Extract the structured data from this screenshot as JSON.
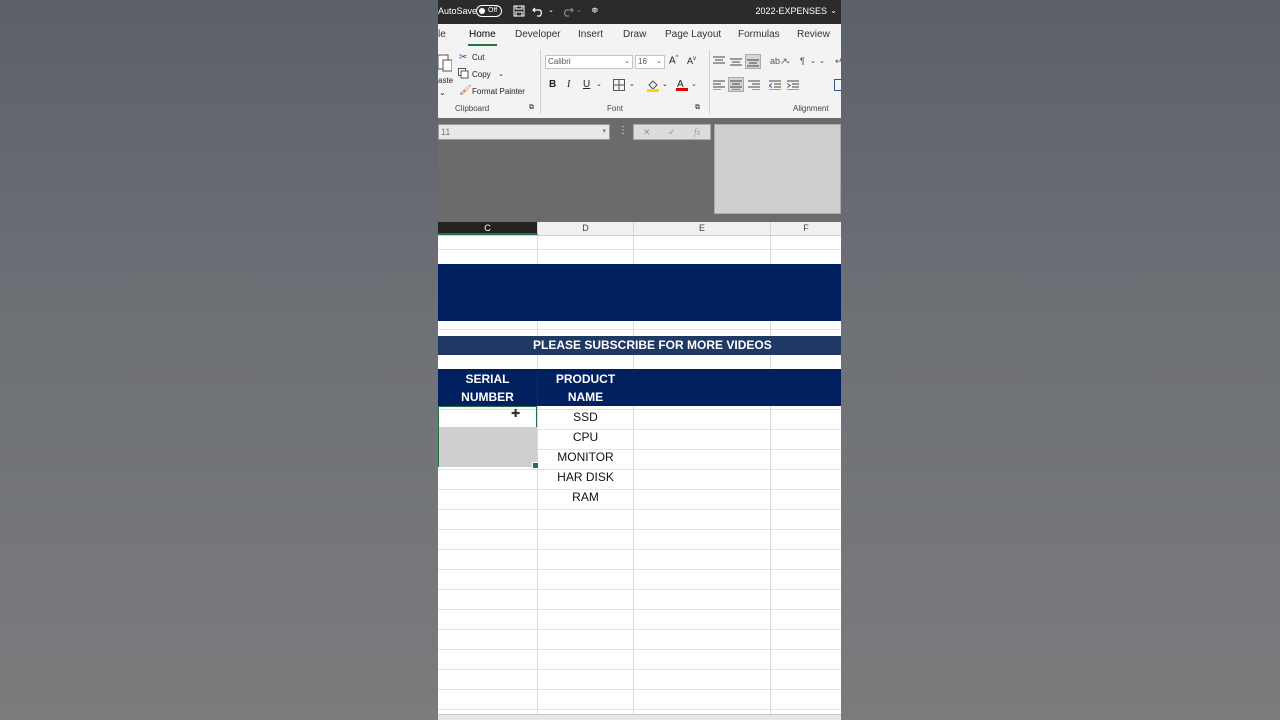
{
  "titlebar": {
    "autosave_label": "AutoSave",
    "autosave_state": "Off",
    "filename": "2022-EXPENSES"
  },
  "tabs": [
    "le",
    "Home",
    "Developer",
    "Insert",
    "Draw",
    "Page Layout",
    "Formulas",
    "Review"
  ],
  "ribbon": {
    "clipboard": {
      "paste_label": "aste",
      "cut": "Cut",
      "copy": "Copy",
      "format_painter": "Format Painter",
      "group_label": "Clipboard"
    },
    "font": {
      "font_name": "Calibri",
      "font_size": "16",
      "bold": "B",
      "italic": "I",
      "underline": "U",
      "group_label": "Font"
    },
    "alignment": {
      "group_label": "Alignment"
    }
  },
  "formula_bar": {
    "name_box": "11",
    "fx": "fx"
  },
  "columns": [
    "C",
    "D",
    "E",
    "F"
  ],
  "sheet": {
    "banner": "PLEASE SUBSCRIBE FOR MORE VIDEOS",
    "header_serial": "SERIAL NUMBER",
    "header_product": "PRODUCT NAME",
    "products": [
      "SSD",
      "CPU",
      "MONITOR",
      "HAR DISK",
      "RAM"
    ]
  },
  "colors": {
    "header_blue": "#002060",
    "banner_blue": "#1f3864",
    "accent_green": "#217346"
  }
}
